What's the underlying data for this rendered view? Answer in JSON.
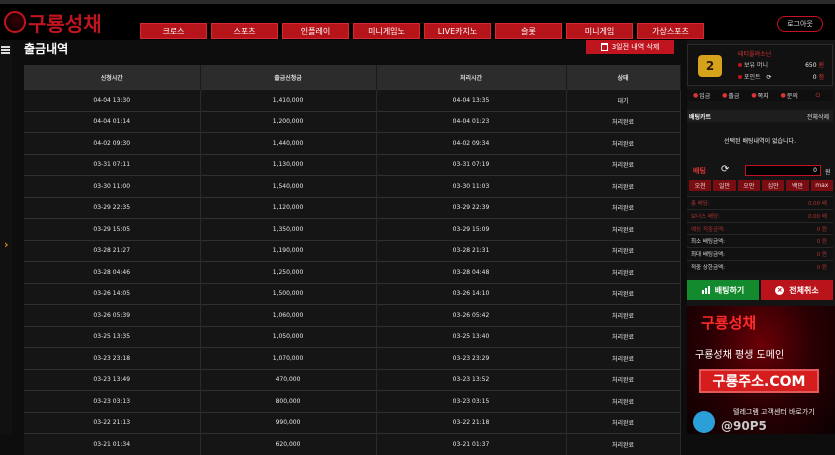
{
  "header": {
    "logo_text": "구룡성채",
    "nav": [
      "크로스",
      "스포츠",
      "인플레이",
      "미니게임노",
      "LIVE카지노",
      "슬롯",
      "미니게임",
      "가상스포츠"
    ],
    "login_label": "로그아웃"
  },
  "page": {
    "title": "출금내역",
    "delete_label": "3일전 내역 삭제"
  },
  "table": {
    "headers": [
      "신청시간",
      "출금신청금",
      "처리시간",
      "상태"
    ],
    "rows": [
      [
        "04-04 13:30",
        "1,410,000",
        "04-04 13:35",
        "대기"
      ],
      [
        "04-04 01:14",
        "1,200,000",
        "04-04 01:23",
        "처리완료"
      ],
      [
        "04-02 09:30",
        "1,440,000",
        "04-02 09:34",
        "처리완료"
      ],
      [
        "03-31 07:11",
        "1,130,000",
        "03-31 07:19",
        "처리완료"
      ],
      [
        "03-30 11:00",
        "1,540,000",
        "03-30 11:03",
        "처리완료"
      ],
      [
        "03-29 22:35",
        "1,120,000",
        "03-29 22:39",
        "처리완료"
      ],
      [
        "03-29 15:05",
        "1,350,000",
        "03-29 15:09",
        "처리완료"
      ],
      [
        "03-28 21:27",
        "1,190,000",
        "03-28 21:31",
        "처리완료"
      ],
      [
        "03-28 04:46",
        "1,250,000",
        "03-28 04:48",
        "처리완료"
      ],
      [
        "03-26 14:05",
        "1,500,000",
        "03-26 14:10",
        "처리완료"
      ],
      [
        "03-26 05:39",
        "1,060,000",
        "03-26 05:42",
        "처리완료"
      ],
      [
        "03-25 13:35",
        "1,050,000",
        "03-25 13:40",
        "처리완료"
      ],
      [
        "03-23 23:18",
        "1,070,000",
        "03-23 23:29",
        "처리완료"
      ],
      [
        "03-23 13:49",
        "470,000",
        "03-23 13:52",
        "처리완료"
      ],
      [
        "03-23 03:13",
        "800,000",
        "03-23 03:15",
        "처리완료"
      ],
      [
        "03-22 21:13",
        "990,000",
        "03-22 21:18",
        "처리완료"
      ],
      [
        "03-21 01:34",
        "620,000",
        "03-21 01:37",
        "처리완료"
      ]
    ]
  },
  "sidebar": {
    "profile": {
      "level": "2",
      "username": "테티올려소닌",
      "money_label": "보유 머니",
      "money_value": "650",
      "money_unit": "원",
      "point_label": "포인트",
      "point_value": "0",
      "point_unit": "점"
    },
    "actions": [
      "입금",
      "출금",
      "쪽지",
      "문의"
    ],
    "betcart": {
      "title": "배팅카트",
      "delete_all": "전체삭제",
      "empty_text": "선택된 배팅내역이 없습니다."
    },
    "bet": {
      "label": "배팅",
      "refresh_icon": "refresh-icon",
      "amount": "0",
      "unit": "원",
      "quick": [
        "오천",
        "일만",
        "오만",
        "십만",
        "백만",
        "max"
      ]
    },
    "stats": [
      {
        "label": "총 배당:",
        "value": "0.00 배"
      },
      {
        "label": "보너스 배당:",
        "value": "0.00 배"
      },
      {
        "label": "예상 적중금액:",
        "value": "0 원"
      },
      {
        "label": "최소 배팅금액:",
        "value": "0 원"
      },
      {
        "label": "최대 배팅금액:",
        "value": "0 원"
      },
      {
        "label": "적중 상한금액:",
        "value": "0 원"
      }
    ],
    "bet_button": "배팅하기",
    "cancel_button": "전체취소",
    "banner": {
      "logo": "구룡성채",
      "line1": "구룡성채 평생 도메인",
      "domain": "구룡주소.COM",
      "telegram": "텔레그램 고객센터 바로가기",
      "bottom": "@90P5"
    }
  }
}
